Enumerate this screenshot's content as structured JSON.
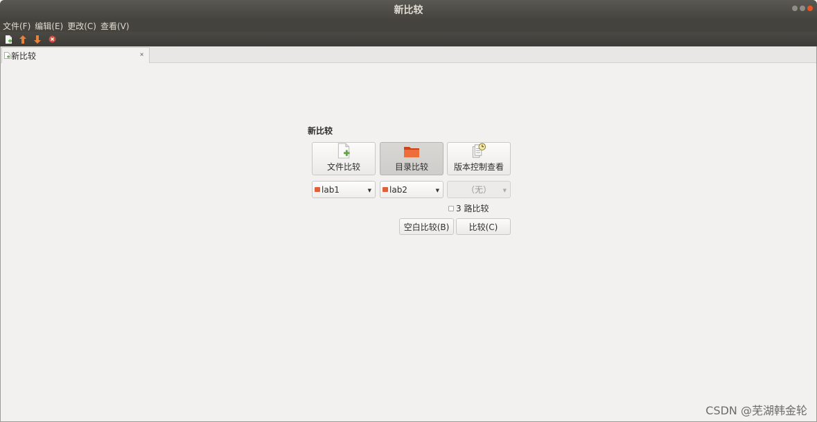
{
  "window": {
    "title": "新比较"
  },
  "menubar": {
    "items": [
      "文件(F)",
      "编辑(E)",
      "更改(C)",
      "查看(V)"
    ]
  },
  "toolbar": {
    "icons": [
      "new-comparison-icon",
      "arrow-up-icon",
      "arrow-down-icon",
      "stop-icon"
    ]
  },
  "tabs": [
    {
      "label": "新比较",
      "close": "×"
    }
  ],
  "new_comparison": {
    "heading": "新比较",
    "buttons": [
      {
        "label": "文件比较",
        "icon": "file-add-icon",
        "active": false
      },
      {
        "label": "目录比较",
        "icon": "folder-icon",
        "active": true
      },
      {
        "label": "版本控制查看",
        "icon": "version-control-icon",
        "active": false
      }
    ],
    "selectors": [
      {
        "value": "lab1",
        "enabled": true
      },
      {
        "value": "lab2",
        "enabled": true
      },
      {
        "value": "（无）",
        "enabled": false
      }
    ],
    "three_way": {
      "label": "3 路比较",
      "checked": false
    },
    "blank_button": "空白比较(B)",
    "compare_button": "比较(C)"
  },
  "watermark": "CSDN @芜湖韩金轮",
  "colors": {
    "accent": "#e95420",
    "titlebar": "#46443f",
    "background": "#f2f1f0"
  }
}
